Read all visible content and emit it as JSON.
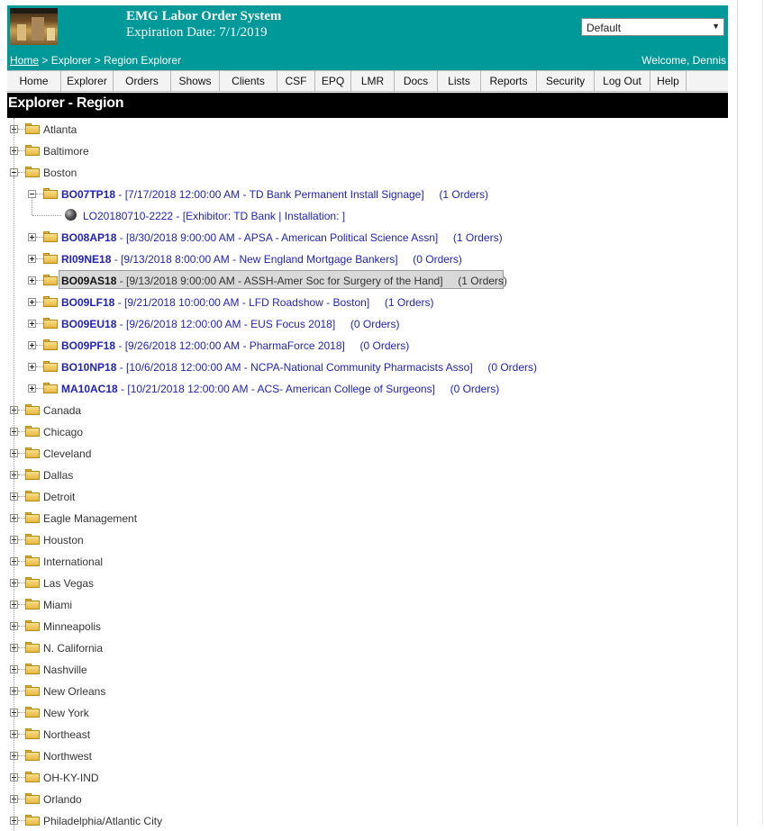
{
  "header": {
    "app_title": "EMG Labor Order System",
    "expiration": "Expiration Date: 7/1/2019",
    "profile_select": "Default"
  },
  "breadcrumb": {
    "home": "Home",
    "rest": " > Explorer > Region Explorer",
    "welcome": "Welcome, Dennis"
  },
  "nav": [
    "Home",
    "Explorer",
    "Orders",
    "Shows",
    "Clients",
    "CSF",
    "EPQ",
    "LMR",
    "Docs",
    "Lists",
    "Reports",
    "Security",
    "Log Out",
    "Help"
  ],
  "page_title": "Explorer - Region",
  "tree": {
    "regions_before": [
      "Atlanta",
      "Baltimore"
    ],
    "expanded_region": "Boston",
    "boston_shows": [
      {
        "code": "BO07TP18",
        "detail": "[7/17/2018 12:00:00 AM - TD Bank Permanent Install Signage]",
        "orders": "(1 Orders)"
      },
      {
        "code": "BO08AP18",
        "detail": "[8/30/2018 9:00:00 AM - APSA - American Political Science Assn]",
        "orders": "(1 Orders)"
      },
      {
        "code": "RI09NE18",
        "detail": "[9/13/2018 8:00:00 AM - New England Mortgage Bankers]",
        "orders": "(0 Orders)"
      },
      {
        "code": "BO09AS18",
        "detail": "[9/13/2018 9:00:00 AM - ASSH-Amer Soc for Surgery of the Hand]",
        "orders": "(1 Orders)"
      },
      {
        "code": "BO09LF18",
        "detail": "[9/21/2018 10:00:00 AM - LFD Roadshow - Boston]",
        "orders": "(1 Orders)"
      },
      {
        "code": "BO09EU18",
        "detail": "[9/26/2018 12:00:00 AM - EUS Focus 2018]",
        "orders": "(0 Orders)"
      },
      {
        "code": "BO09PF18",
        "detail": "[9/26/2018 12:00:00 AM - PharmaForce 2018]",
        "orders": "(0 Orders)"
      },
      {
        "code": "BO10NP18",
        "detail": "[10/6/2018 12:00:00 AM - NCPA-National Community Pharmacists Asso]",
        "orders": "(0 Orders)"
      },
      {
        "code": "MA10AC18",
        "detail": "[10/21/2018 12:00:00 AM - ACS- American College of Surgeons]",
        "orders": "(0 Orders)"
      }
    ],
    "order_item": "LO20180710-2222 - [Exhibitor: TD Bank | Installation: ]",
    "selected_show": "BO09AS18",
    "regions_after": [
      "Canada",
      "Chicago",
      "Cleveland",
      "Dallas",
      "Detroit",
      "Eagle Management",
      "Houston",
      "International",
      "Las Vegas",
      "Miami",
      "Minneapolis",
      "N. California",
      "Nashville",
      "New Orleans",
      "New York",
      "Northeast",
      "Northwest",
      "OH-KY-IND",
      "Orlando",
      "Philadelphia/Atlantic City"
    ]
  },
  "colors": {
    "header_bg": "#009999",
    "link_blue": "#2222bb",
    "title_bar": "#000000",
    "selected_bg": "#d9d9d9"
  }
}
